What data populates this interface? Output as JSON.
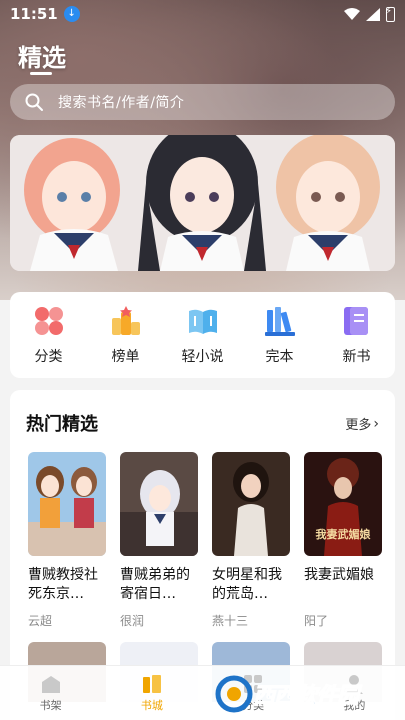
{
  "status": {
    "time": "11:51"
  },
  "header": {
    "title": "精选"
  },
  "search": {
    "placeholder": "搜索书名/作者/简介"
  },
  "categories": [
    {
      "label": "分类",
      "icon": "grid-icon",
      "color": "#f26b6b"
    },
    {
      "label": "榜单",
      "icon": "ranking-icon",
      "color": "#f7a928"
    },
    {
      "label": "轻小说",
      "icon": "open-book-icon",
      "color": "#4fb0ec"
    },
    {
      "label": "完本",
      "icon": "books-icon",
      "color": "#3e8af2"
    },
    {
      "label": "新书",
      "icon": "new-book-icon",
      "color": "#8a6cf2"
    }
  ],
  "hot": {
    "title": "热门精选",
    "more": "更多",
    "books": [
      {
        "title": "曹贼教授社死东京…",
        "author": "云超"
      },
      {
        "title": "曹贼弟弟的寄宿日…",
        "author": "很润"
      },
      {
        "title": "女明星和我的荒岛…",
        "author": "燕十三"
      },
      {
        "title": "我妻武媚娘",
        "author": "阳了",
        "cover_text": "我妻武媚娘"
      }
    ]
  },
  "tabs": [
    {
      "label": "书架",
      "icon": "bookshelf-icon"
    },
    {
      "label": "书城",
      "icon": "bookstore-icon",
      "active": true
    },
    {
      "label": "分类",
      "icon": "category-icon"
    },
    {
      "label": "我的",
      "icon": "profile-icon"
    }
  ],
  "watermark": {
    "text": "西西软件园"
  },
  "colors": {
    "accent": "#f0a500",
    "link": "#1e73c8"
  }
}
